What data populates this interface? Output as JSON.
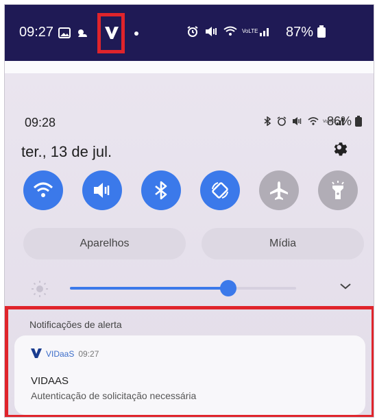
{
  "status_bar": {
    "time": "09:27",
    "battery": "87%",
    "icons": [
      "gallery-icon",
      "weather-icon",
      "vidaas-v-icon",
      "dot-icon",
      "alarm-icon",
      "mute-icon",
      "wifi-icon",
      "signal-icon"
    ]
  },
  "panel": {
    "time": "09:28",
    "battery": "86%",
    "date": "ter., 13 de jul.",
    "quick_settings": [
      {
        "name": "wifi",
        "state": "on"
      },
      {
        "name": "mute",
        "state": "on"
      },
      {
        "name": "bluetooth",
        "state": "on"
      },
      {
        "name": "auto-rotate",
        "state": "on"
      },
      {
        "name": "airplane",
        "state": "off"
      },
      {
        "name": "flashlight",
        "state": "off"
      }
    ],
    "pills": {
      "devices": "Aparelhos",
      "media": "Mídia"
    },
    "brightness": 0.7
  },
  "alerts": {
    "title": "Notificações de alerta",
    "notification": {
      "app_name": "VIDaaS",
      "time": "09:27",
      "title": "VIDAAS",
      "body": "Autenticação de solicitação necessária"
    }
  },
  "colors": {
    "accent": "#3b79ea",
    "highlight": "#e0242b",
    "topbar": "#1f1a55"
  }
}
